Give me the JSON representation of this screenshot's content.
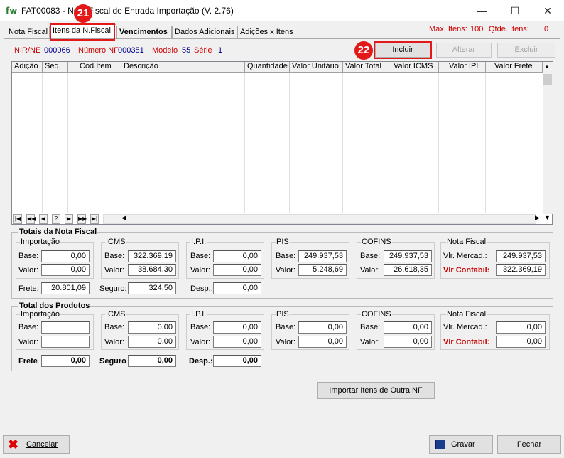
{
  "window": {
    "app_icon": "fw",
    "title": "FAT00083 - Nota Fiscal de Entrada Importação (V. 2.76)",
    "minimize": "—",
    "maximize": "☐",
    "close": "✕"
  },
  "tabs": [
    {
      "label": "Nota Fiscal"
    },
    {
      "label": "Itens da N.Fiscal"
    },
    {
      "label": "Vencimentos"
    },
    {
      "label": "Dados Adicionais"
    },
    {
      "label": "Adições x Itens"
    }
  ],
  "header": {
    "max_itens_label": "Max. Itens:",
    "max_itens_value": "100",
    "qtde_itens_label": "Qtde. Itens:",
    "qtde_itens_value": "0",
    "nir_label": "NIR/NE",
    "nir_value": "000066",
    "numero_label": "Número NF",
    "numero_value": "000351",
    "modelo_label": "Modelo",
    "modelo_value": "55",
    "serie_label": "Série",
    "serie_value": "1"
  },
  "actions": {
    "incluir": "Incluir",
    "alterar": "Alterar",
    "excluir": "Excluir"
  },
  "callouts": {
    "tab": "21",
    "incluir": "22"
  },
  "grid": {
    "columns": [
      "Adição",
      "Seq.",
      "Cód.Item",
      "Descrição",
      "Quantidade",
      "Valor Unitário",
      "Valor Total",
      "Valor ICMS",
      "Valor IPI",
      "Valor Frete"
    ],
    "nav": [
      "|◀",
      "◀◀",
      "◀",
      "?",
      "▶",
      "▶▶",
      "▶|"
    ]
  },
  "totais_nf": {
    "title": "Totais da Nota Fiscal",
    "importacao": {
      "title": "Importação",
      "base_label": "Base:",
      "base": "0,00",
      "valor_label": "Valor:",
      "valor": "0,00"
    },
    "icms": {
      "title": "ICMS",
      "base_label": "Base:",
      "base": "322.369,19",
      "valor_label": "Valor:",
      "valor": "38.684,30"
    },
    "ipi": {
      "title": "I.P.I.",
      "base_label": "Base:",
      "base": "0,00",
      "valor_label": "Valor:",
      "valor": "0,00"
    },
    "pis": {
      "title": "PIS",
      "base_label": "Base:",
      "base": "249.937,53",
      "valor_label": "Valor:",
      "valor": "5.248,69"
    },
    "cofins": {
      "title": "COFINS",
      "base_label": "Base:",
      "base": "249.937,53",
      "valor_label": "Valor:",
      "valor": "26.618,35"
    },
    "nota": {
      "title": "Nota Fiscal",
      "mercad_label": "Vlr. Mercad.:",
      "mercad": "249.937,53",
      "contabil_label": "Vlr Contabil:",
      "contabil": "322.369,19"
    },
    "frete_label": "Frete:",
    "frete": "20.801,09",
    "seguro_label": "Seguro:",
    "seguro": "324,50",
    "desp_label": "Desp.:",
    "desp": "0,00"
  },
  "totais_prod": {
    "title": "Total dos Produtos",
    "importacao": {
      "title": "Importação",
      "base_label": "Base:",
      "base": "",
      "valor_label": "Valor:",
      "valor": ""
    },
    "icms": {
      "title": "ICMS",
      "base_label": "Base:",
      "base": "0,00",
      "valor_label": "Valor:",
      "valor": "0,00"
    },
    "ipi": {
      "title": "I.P.I.",
      "base_label": "Base:",
      "base": "0,00",
      "valor_label": "Valor:",
      "valor": "0,00"
    },
    "pis": {
      "title": "PIS",
      "base_label": "Base:",
      "base": "0,00",
      "valor_label": "Valor:",
      "valor": "0,00"
    },
    "cofins": {
      "title": "COFINS",
      "base_label": "Base:",
      "base": "0,00",
      "valor_label": "Valor:",
      "valor": "0,00"
    },
    "nota": {
      "title": "Nota Fiscal",
      "mercad_label": "Vlr. Mercad.:",
      "mercad": "0,00",
      "contabil_label": "Vlr Contabil:",
      "contabil": "0,00"
    },
    "frete_label": "Frete",
    "frete": "0,00",
    "seguro_label": "Seguro",
    "seguro": "0,00",
    "desp_label": "Desp.:",
    "desp": "0,00"
  },
  "importar_button": "Importar Itens de Outra NF",
  "footer": {
    "cancelar": "Cancelar",
    "gravar": "Gravar",
    "fechar": "Fechar"
  }
}
